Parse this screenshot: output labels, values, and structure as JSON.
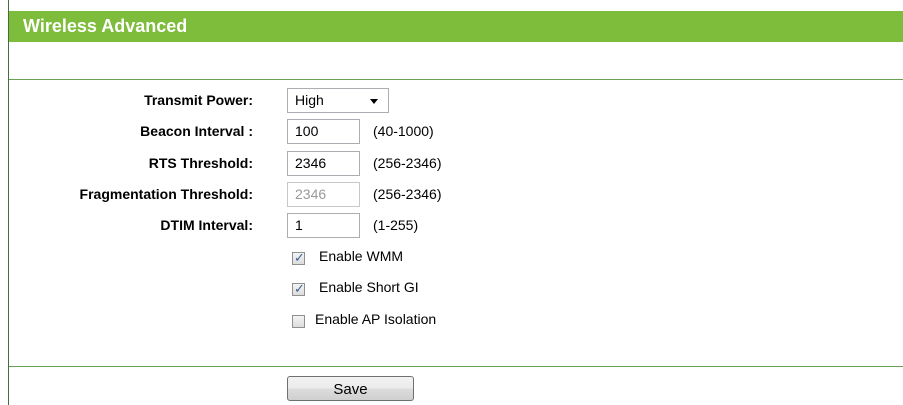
{
  "page": {
    "title": "Wireless Advanced"
  },
  "form": {
    "transmit_power": {
      "label": "Transmit Power:",
      "value": "High",
      "options": [
        "High"
      ]
    },
    "beacon_interval": {
      "label": "Beacon Interval :",
      "value": "100",
      "range": "(40-1000)"
    },
    "rts_threshold": {
      "label": "RTS Threshold:",
      "value": "2346",
      "range": "(256-2346)"
    },
    "fragmentation_threshold": {
      "label": "Fragmentation Threshold:",
      "value": "2346",
      "range": "(256-2346)",
      "disabled": true
    },
    "dtim_interval": {
      "label": "DTIM Interval:",
      "value": "1",
      "range": "(1-255)"
    },
    "checkboxes": [
      {
        "label": "Enable WMM",
        "checked": true
      },
      {
        "label": "Enable Short GI",
        "checked": true
      },
      {
        "label": "Enable AP Isolation",
        "checked": false
      }
    ]
  },
  "actions": {
    "save_label": "Save"
  },
  "colors": {
    "title_bar": "#7dbd3b",
    "rule": "#6a9f58",
    "check": "#3c5f95"
  },
  "icons": {
    "select_caret": "chevron-down-icon",
    "check": "checkmark-icon"
  }
}
